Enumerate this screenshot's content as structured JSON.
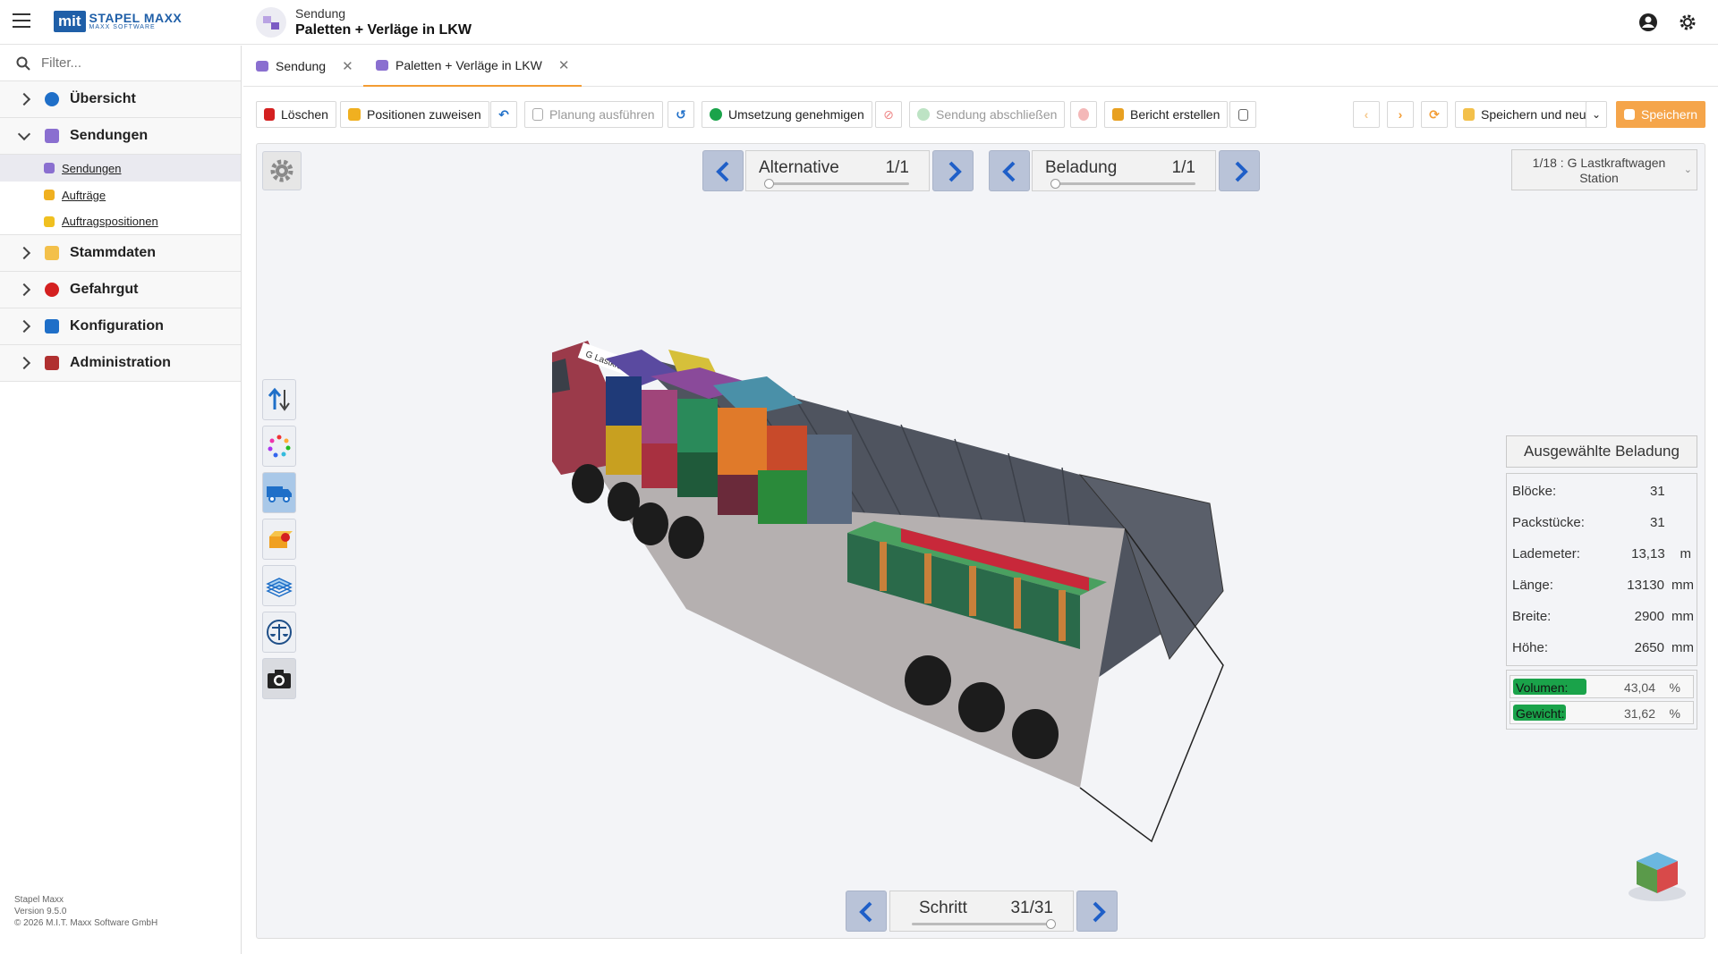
{
  "app": {
    "logo_text": "mit",
    "logo_title": "STAPEL MAXX",
    "logo_subtitle": "MAXX SOFTWARE",
    "breadcrumb_parent": "Sendung",
    "breadcrumb_title": "Paletten + Verläge in LKW"
  },
  "sidebar": {
    "filter_placeholder": "Filter...",
    "items": [
      {
        "label": "Übersicht",
        "icon": "globe-icon",
        "color": "#1f6fc8"
      },
      {
        "label": "Sendungen",
        "icon": "shipment-icon",
        "color": "#7b5bc4"
      },
      {
        "label": "Stammdaten",
        "icon": "folder-icon",
        "color": "#f0a020"
      },
      {
        "label": "Gefahrgut",
        "icon": "warning-icon",
        "color": "#d42020"
      },
      {
        "label": "Konfiguration",
        "icon": "config-icon",
        "color": "#1f6fc8"
      },
      {
        "label": "Administration",
        "icon": "admin-icon",
        "color": "#b03030"
      }
    ],
    "subitems": [
      {
        "label": "Sendungen",
        "icon": "shipment-icon"
      },
      {
        "label": "Aufträge",
        "icon": "order-icon"
      },
      {
        "label": "Auftragspositionen",
        "icon": "order-position-icon"
      }
    ],
    "footer": {
      "name": "Stapel Maxx",
      "version": "Version 9.5.0",
      "copyright": "© 2026 M.I.T. Maxx Software GmbH"
    }
  },
  "tabs": [
    {
      "label": "Sendung"
    },
    {
      "label": "Paletten + Verläge in LKW"
    }
  ],
  "toolbar": {
    "delete": "Löschen",
    "assign_positions": "Positionen zuweisen",
    "run_planning": "Planung ausführen",
    "approve": "Umsetzung genehmigen",
    "close_shipment": "Sendung abschließen",
    "create_report": "Bericht erstellen",
    "save_and_new": "Speichern und neu",
    "save": "Speichern"
  },
  "viewer": {
    "alternative_label": "Alternative",
    "alternative_value": "1/1",
    "loading_label": "Beladung",
    "loading_value": "1/1",
    "vehicle_select": "1/18 : G Lastkraftwagen Station",
    "truck_sign": "G Lastkraftwagen",
    "step_label": "Schritt",
    "step_value": "31/31"
  },
  "info": {
    "title": "Ausgewählte Beladung",
    "rows": [
      {
        "label": "Blöcke:",
        "value": "31",
        "unit": ""
      },
      {
        "label": "Packstücke:",
        "value": "31",
        "unit": ""
      },
      {
        "label": "Lademeter:",
        "value": "13,13",
        "unit": "m"
      },
      {
        "label": "Länge:",
        "value": "13130",
        "unit": "mm"
      },
      {
        "label": "Breite:",
        "value": "2900",
        "unit": "mm"
      },
      {
        "label": "Höhe:",
        "value": "2650",
        "unit": "mm"
      }
    ],
    "volume": {
      "label": "Volumen:",
      "value": "43,04",
      "unit": "%",
      "fraction": 0.4304
    },
    "weight": {
      "label": "Gewicht:",
      "value": "31,62",
      "unit": "%",
      "fraction": 0.3162
    }
  },
  "colors": {
    "accent": "#f39c33",
    "brand": "#1f5fa8",
    "progress": "#1aa34a"
  }
}
